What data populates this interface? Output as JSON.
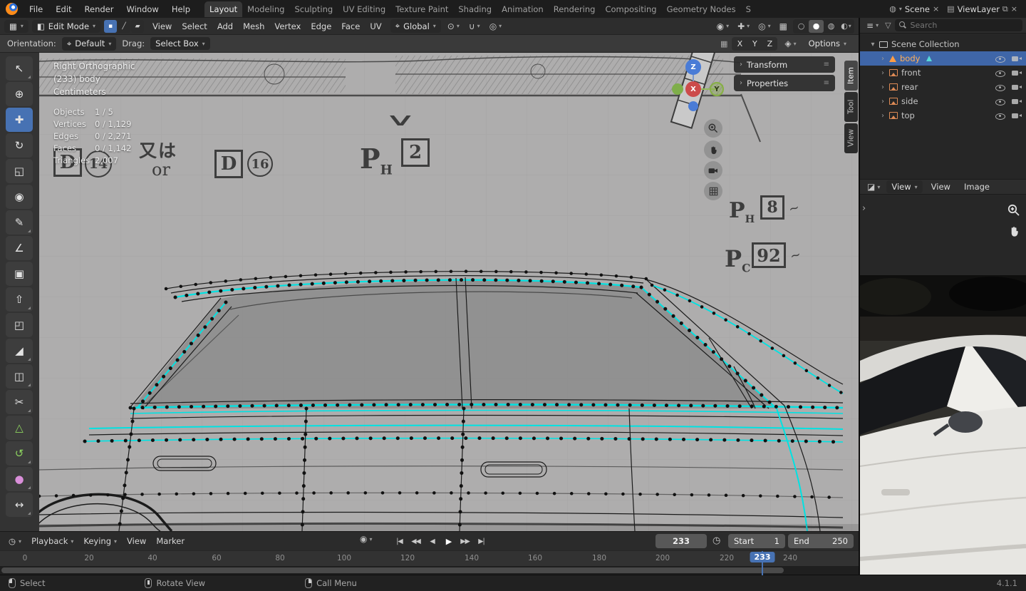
{
  "ui": {
    "caret": "▾",
    "chev": "›",
    "grip": "≡",
    "tilde": "∼",
    "check": "∨"
  },
  "icons": {
    "editor_viewport": "▦",
    "editor_timeline": "◷",
    "editor_outliner": "≡",
    "editor_image": "◪",
    "mode_cube": "◧",
    "vertex_mode": "▪",
    "edge_mode": "╱",
    "face_mode": "▰",
    "orientation": "⌖",
    "pivot": "⊙",
    "snap": "∪",
    "proportional": "◎",
    "visibility": "◉",
    "gizmo": "✚",
    "overlays": "◎",
    "xray": "▦",
    "shade_wire": "○",
    "shade_solid": "●",
    "shade_material": "◍",
    "shade_render": "◐",
    "scene": "◍",
    "viewlayer": "▤",
    "copy": "⧉",
    "close": "×",
    "record": "◉",
    "clock": "◷",
    "filter": "▽",
    "mirror": "▦",
    "snap_option": "◈"
  },
  "topbar": {
    "menus": [
      "File",
      "Edit",
      "Render",
      "Window",
      "Help"
    ],
    "tabs": [
      "Layout",
      "Modeling",
      "Sculpting",
      "UV Editing",
      "Texture Paint",
      "Shading",
      "Animation",
      "Rendering",
      "Compositing",
      "Geometry Nodes",
      "S"
    ],
    "scene_label": "Scene",
    "viewlayer_label": "ViewLayer"
  },
  "vp_header": {
    "mode": "Edit Mode",
    "menus": [
      "View",
      "Select",
      "Add",
      "Mesh",
      "Vertex",
      "Edge",
      "Face",
      "UV"
    ],
    "orientation": "Global"
  },
  "tool_settings": {
    "orientation_label": "Orientation:",
    "orientation_value": "Default",
    "drag_label": "Drag:",
    "drag_value": "Select Box",
    "axes": [
      "X",
      "Y",
      "Z"
    ],
    "options_label": "Options"
  },
  "toolbar": {
    "tools": [
      {
        "name": "tweak-select",
        "glyph": "↖"
      },
      {
        "name": "cursor",
        "glyph": "⊕"
      },
      {
        "name": "move",
        "glyph": "✚"
      },
      {
        "name": "rotate",
        "glyph": "↻"
      },
      {
        "name": "scale",
        "glyph": "◱"
      },
      {
        "name": "transform",
        "glyph": "◉"
      },
      {
        "name": "annotate",
        "glyph": "✎"
      },
      {
        "name": "measure",
        "glyph": "∠"
      },
      {
        "name": "add-cube",
        "glyph": "▣"
      },
      {
        "name": "extrude",
        "glyph": "⇧"
      },
      {
        "name": "inset",
        "glyph": "◰"
      },
      {
        "name": "bevel",
        "glyph": "◢"
      },
      {
        "name": "loop-cut",
        "glyph": "◫"
      },
      {
        "name": "knife",
        "glyph": "✂"
      },
      {
        "name": "poly-build",
        "glyph": "△"
      },
      {
        "name": "spin",
        "glyph": "↺"
      },
      {
        "name": "smooth",
        "glyph": "●"
      },
      {
        "name": "edge-slide",
        "glyph": "↔"
      }
    ]
  },
  "viewport": {
    "view_name": "Right Orthographic",
    "object_name": "(233) body",
    "units": "Centimeters",
    "stats": [
      {
        "label": "Objects",
        "value": "1 / 5"
      },
      {
        "label": "Vertices",
        "value": "0 / 1,129"
      },
      {
        "label": "Edges",
        "value": "0 / 2,271"
      },
      {
        "label": "Faces",
        "value": "0 / 1,142"
      },
      {
        "label": "Triangles",
        "value": "2,007"
      }
    ],
    "gizmo": {
      "x": "X",
      "y": "Y",
      "z": "Z"
    },
    "npanel_sections": [
      "Transform",
      "Properties"
    ],
    "npanel_tabs": [
      "Item",
      "Tool",
      "View"
    ],
    "blueprint": {
      "d14_letter": "D",
      "d14_number": "14",
      "matawa": "又は",
      "or_text": "or",
      "d16_letter": "D",
      "d16_number": "16",
      "p_letter": "P",
      "h_sub": "H",
      "c_sub": "C",
      "ph2_number": "2",
      "ph8_number": "8",
      "pc92_number": "92"
    }
  },
  "outliner": {
    "search_placeholder": "Search",
    "root_label": "Scene Collection",
    "items": [
      {
        "label": "body"
      },
      {
        "label": "front"
      },
      {
        "label": "rear"
      },
      {
        "label": "side"
      },
      {
        "label": "top"
      }
    ]
  },
  "image_editor": {
    "mode": "View",
    "menus": [
      "View",
      "Image"
    ]
  },
  "timeline": {
    "menus": [
      "Playback",
      "Keying",
      "View",
      "Marker"
    ],
    "transport": [
      {
        "name": "jump-to-start",
        "glyph": "|◀"
      },
      {
        "name": "prev-keyframe",
        "glyph": "◀◀"
      },
      {
        "name": "play-reverse",
        "glyph": "◀"
      },
      {
        "name": "play",
        "glyph": "▶"
      },
      {
        "name": "next-keyframe",
        "glyph": "▶▶"
      },
      {
        "name": "jump-to-end",
        "glyph": "▶|"
      }
    ],
    "current_frame": "233",
    "start_label": "Start",
    "start_value": "1",
    "end_label": "End",
    "end_value": "250",
    "ticks": [
      "0",
      "20",
      "40",
      "60",
      "80",
      "100",
      "120",
      "140",
      "160",
      "180",
      "200",
      "220",
      "240"
    ]
  },
  "statusbar": {
    "hints": [
      "Select",
      "Rotate View",
      "Call Menu"
    ],
    "version": "4.1.1"
  }
}
